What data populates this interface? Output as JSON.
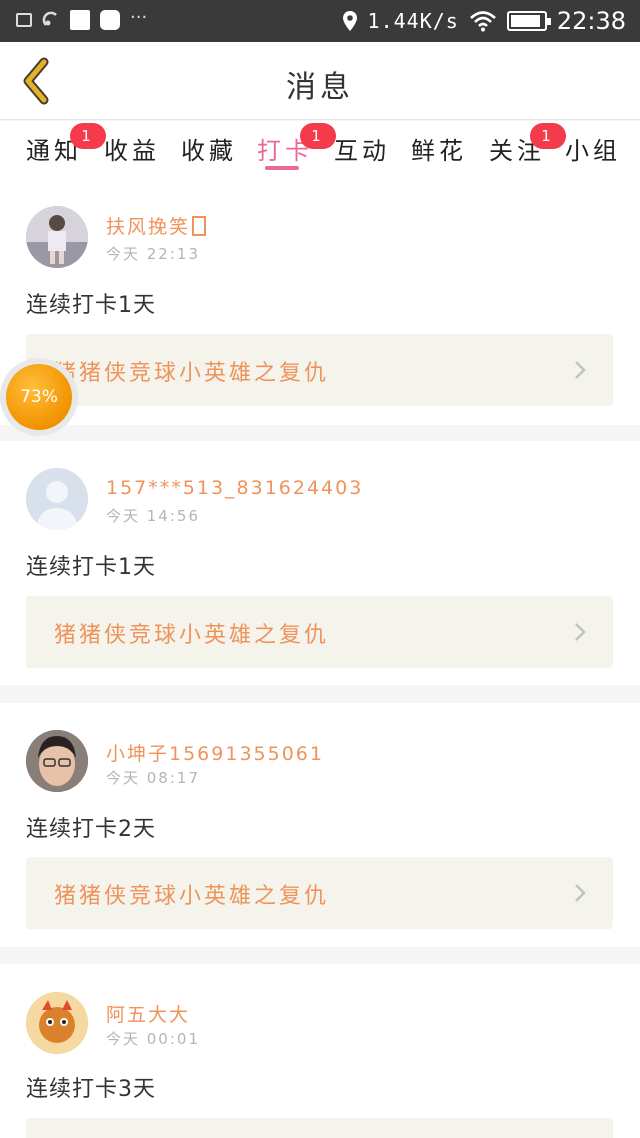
{
  "status_bar": {
    "network_speed": "1.44K/s",
    "time": "22:38",
    "more": "···",
    "battery_level": 0.9
  },
  "header": {
    "title": "消息",
    "back_icon": "chevron-left-icon"
  },
  "tabs": [
    {
      "label": "通知",
      "badge": "1"
    },
    {
      "label": "收益",
      "badge": ""
    },
    {
      "label": "收藏",
      "badge": ""
    },
    {
      "label": "打卡",
      "badge": "1",
      "active": true
    },
    {
      "label": "互动",
      "badge": ""
    },
    {
      "label": "鲜花",
      "badge": ""
    },
    {
      "label": "关注",
      "badge": "1"
    },
    {
      "label": "小组",
      "badge": ""
    }
  ],
  "feed": [
    {
      "name": "扶风挽笑",
      "time": "今天 22:13",
      "content": "连续打卡1天",
      "game": "猪猪侠竞球小英雄之复仇"
    },
    {
      "name": "157***513_831624403",
      "time": "今天 14:56",
      "content": "连续打卡1天",
      "game": "猪猪侠竞球小英雄之复仇"
    },
    {
      "name": "小坤子15691355061",
      "time": "今天 08:17",
      "content": "连续打卡2天",
      "game": "猪猪侠竞球小英雄之复仇"
    },
    {
      "name": "阿五大大",
      "time": "今天 00:01",
      "content": "连续打卡3天",
      "game": ""
    }
  ],
  "float_ball": {
    "label": "73%"
  },
  "colors": {
    "accent": "#ea6a95",
    "name": "#f0935b",
    "badge": "#f43b4b",
    "back_icon": "#e0b32a"
  }
}
